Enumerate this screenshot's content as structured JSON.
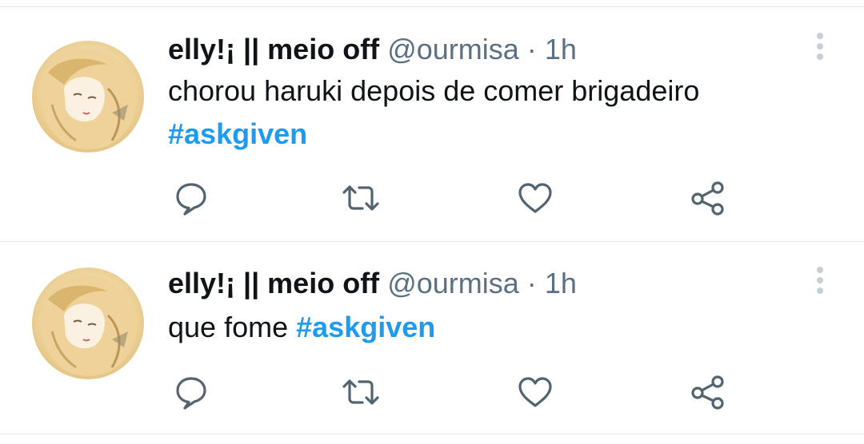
{
  "tweets": [
    {
      "display_name": "elly!¡ || meio off",
      "handle": "@ourmisa",
      "separator": "·",
      "time": "1h",
      "text": "chorou haruki depois de comer brigadeiro",
      "hashtag": "#askgiven"
    },
    {
      "display_name": "elly!¡ || meio off",
      "handle": "@ourmisa",
      "separator": "·",
      "time": "1h",
      "text": "que fome",
      "hashtag": "#askgiven"
    }
  ],
  "icons": {
    "reply": "speech-bubble-icon",
    "retweet": "retweet-arrows-icon",
    "like": "heart-icon",
    "share": "share-nodes-icon",
    "more": "vertical-dots-icon"
  },
  "colors": {
    "text": "#0f1419",
    "secondary": "#5b7083",
    "hashtag": "#1d9bf0",
    "divider": "#e6e9ec",
    "icon": "#536471"
  }
}
